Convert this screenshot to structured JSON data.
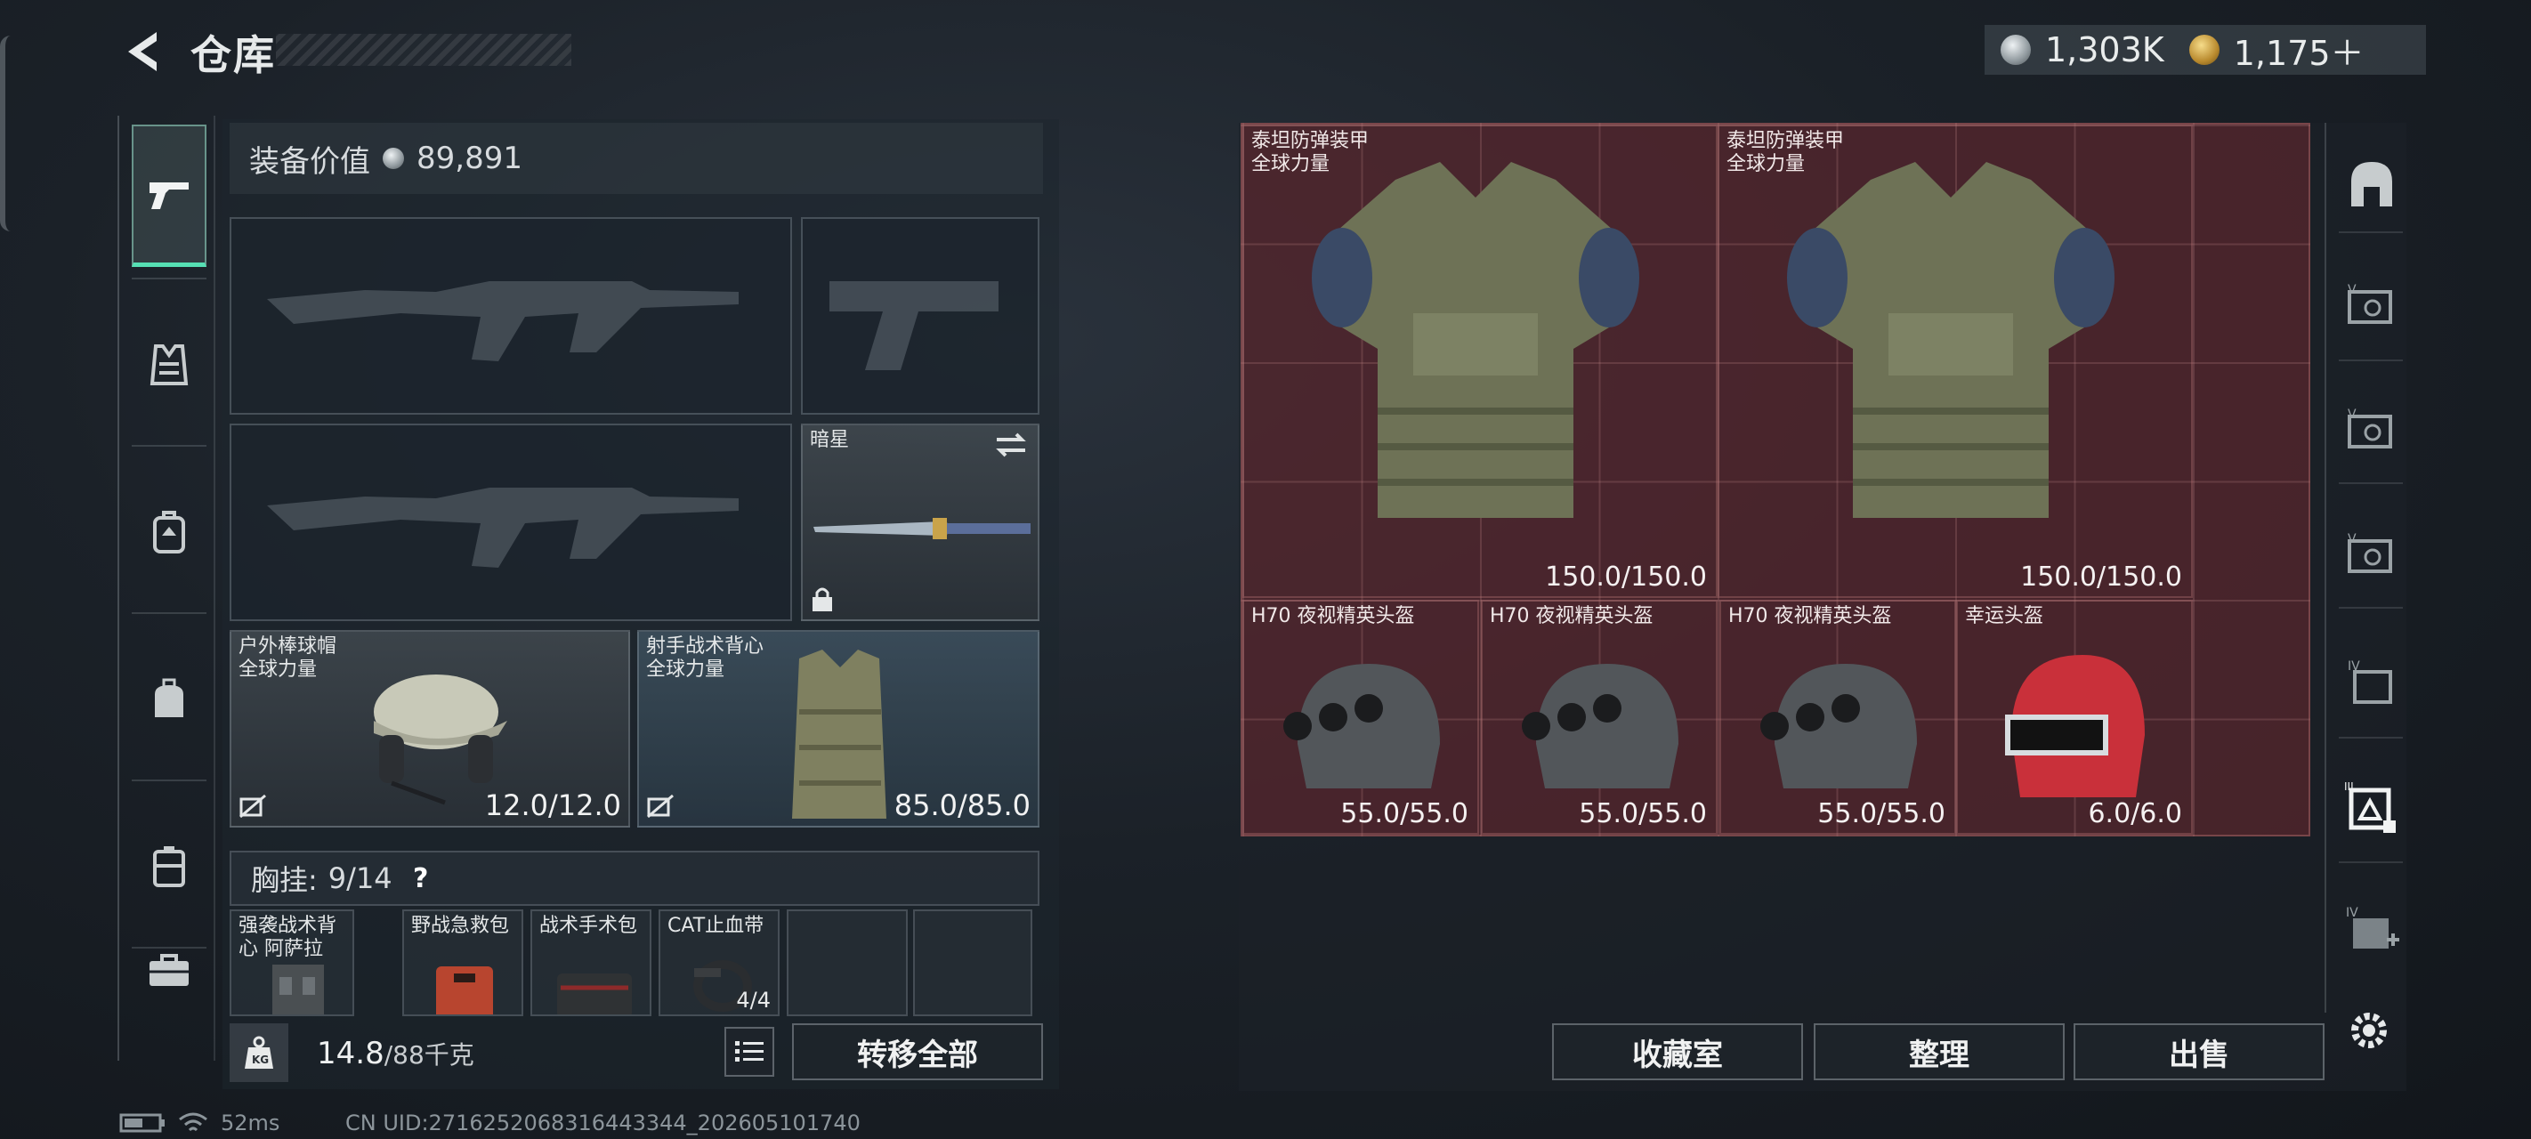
{
  "header": {
    "title": "仓库",
    "currency_1": "1,303K",
    "currency_2": "1,175＋"
  },
  "loadout": {
    "value_label": "装备价值",
    "value": "89,891",
    "secondary_knife_name": "暗星",
    "helmet": {
      "name": "户外棒球帽",
      "sub": "全球力量",
      "durability": "12.0/12.0"
    },
    "armor": {
      "name": "射手战术背心",
      "sub": "全球力量",
      "durability": "85.0/85.0"
    },
    "chest_rig_label": "胸挂:",
    "chest_rig_count": "9/14",
    "help": "?",
    "pouches": [
      {
        "name": "强袭战术背心 阿萨拉"
      },
      {
        "name": "野战急救包"
      },
      {
        "name": "战术手术包"
      },
      {
        "name": "CAT止血带",
        "count": "4/4"
      },
      {
        "name": ""
      },
      {
        "name": ""
      }
    ],
    "weight_value": "14.8",
    "weight_max": "/88千克",
    "transfer_all": "转移全部"
  },
  "storage": {
    "items": [
      {
        "name": "泰坦防弹装甲",
        "sub": "全球力量",
        "durability": "150.0/150.0"
      },
      {
        "name": "泰坦防弹装甲",
        "sub": "全球力量",
        "durability": "150.0/150.0"
      },
      {
        "name": "H70 夜视精英头盔",
        "durability": "55.0/55.0"
      },
      {
        "name": "H70 夜视精英头盔",
        "durability": "55.0/55.0"
      },
      {
        "name": "H70 夜视精英头盔",
        "durability": "55.0/55.0"
      },
      {
        "name": "幸运头盔",
        "durability": "6.0/6.0"
      }
    ],
    "vault": "收藏室",
    "sort": "整理",
    "sell": "出售"
  },
  "status": {
    "ping": "52ms",
    "uid": "CN UID:2716252068316443344_202605101740"
  },
  "colors": {
    "accent": "#56e0b4",
    "storage_bg": "#6e2830"
  }
}
